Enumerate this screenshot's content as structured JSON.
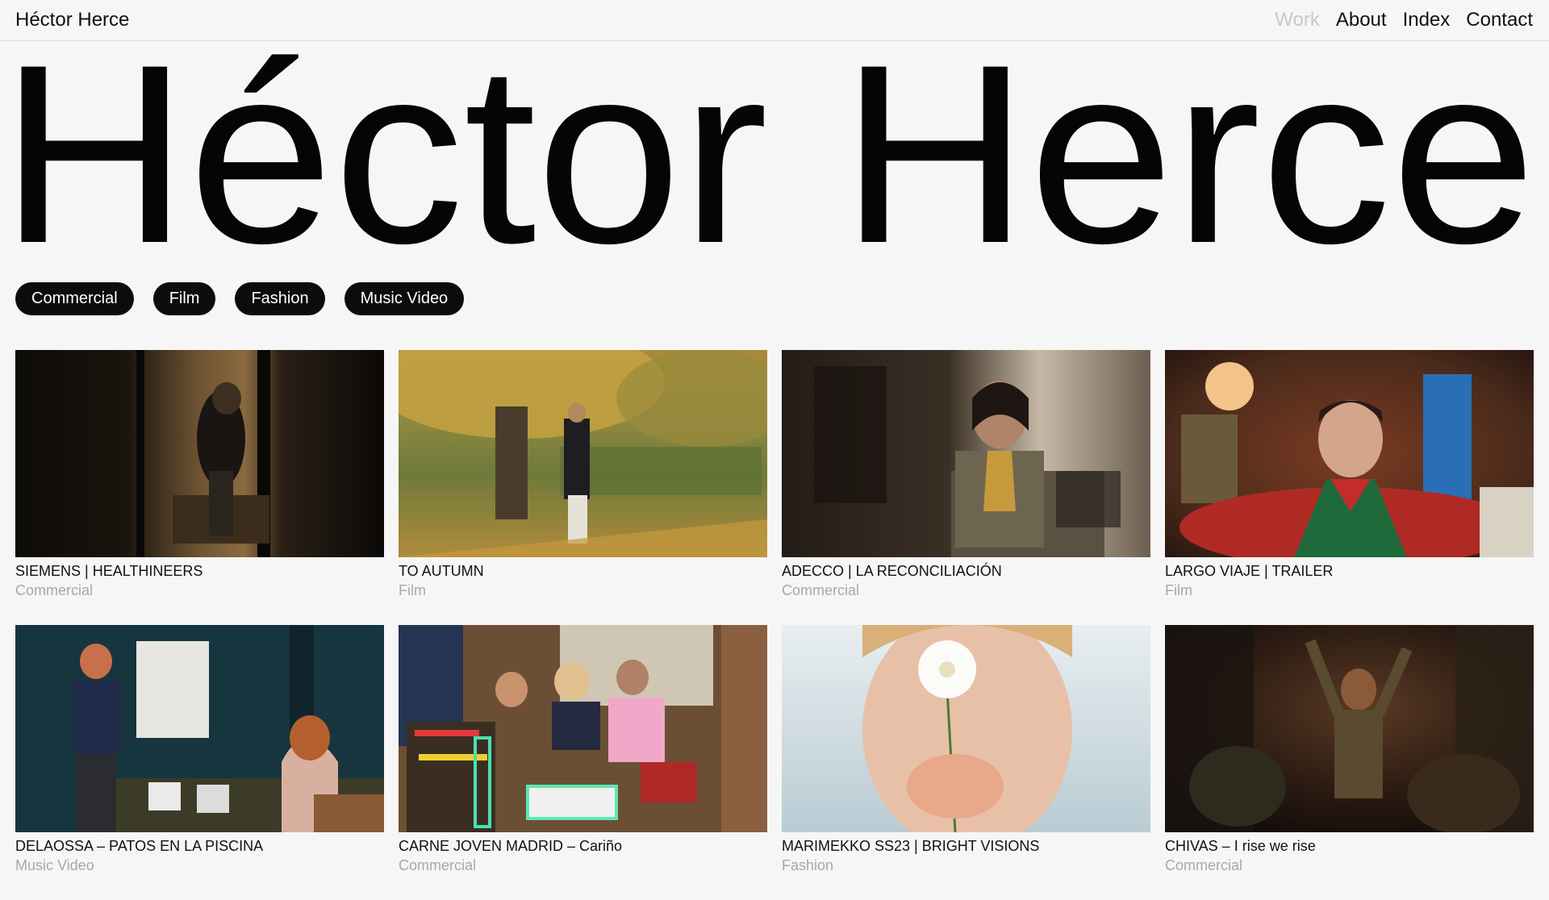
{
  "header": {
    "brand": "Héctor Herce",
    "nav": [
      {
        "label": "Work",
        "active": true
      },
      {
        "label": "About",
        "active": false
      },
      {
        "label": "Index",
        "active": false
      },
      {
        "label": "Contact",
        "active": false
      }
    ]
  },
  "hero": {
    "title": "Héctor Herce"
  },
  "filters": [
    "Commercial",
    "Film",
    "Fashion",
    "Music Video"
  ],
  "projects": [
    {
      "title": "SIEMENS | HEALTHINEERS",
      "category": "Commercial",
      "scene": "dim-bedroom"
    },
    {
      "title": "TO AUTUMN",
      "category": "Film",
      "scene": "autumn-park"
    },
    {
      "title": "ADECCO | LA RECONCILIACIÓN",
      "category": "Commercial",
      "scene": "office-woman"
    },
    {
      "title": "LARGO VIAJE | TRAILER",
      "category": "Film",
      "scene": "boy-red-room"
    },
    {
      "title": "DELAOSSA – PATOS EN LA PISCINA",
      "category": "Music Video",
      "scene": "teal-living-room"
    },
    {
      "title": "CARNE JOVEN MADRID – Cariño",
      "category": "Commercial",
      "scene": "friends-books"
    },
    {
      "title": "MARIMEKKO SS23 | BRIGHT VISIONS",
      "category": "Fashion",
      "scene": "flower-portrait"
    },
    {
      "title": "CHIVAS – I rise we rise",
      "category": "Commercial",
      "scene": "dark-party"
    }
  ],
  "colors": {
    "background": "#f6f6f6",
    "text": "#111111",
    "muted": "#a8a8a8",
    "nav_active": "#c9c9c9",
    "pill": "#0c0c0c"
  }
}
